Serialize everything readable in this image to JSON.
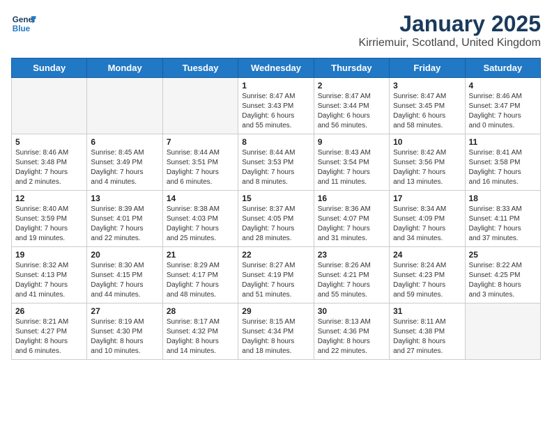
{
  "header": {
    "logo_line1": "General",
    "logo_line2": "Blue",
    "month": "January 2025",
    "location": "Kirriemuir, Scotland, United Kingdom"
  },
  "days_of_week": [
    "Sunday",
    "Monday",
    "Tuesday",
    "Wednesday",
    "Thursday",
    "Friday",
    "Saturday"
  ],
  "weeks": [
    [
      {
        "day": "",
        "content": "",
        "empty": true
      },
      {
        "day": "",
        "content": "",
        "empty": true
      },
      {
        "day": "",
        "content": "",
        "empty": true
      },
      {
        "day": "1",
        "content": "Sunrise: 8:47 AM\nSunset: 3:43 PM\nDaylight: 6 hours\nand 55 minutes."
      },
      {
        "day": "2",
        "content": "Sunrise: 8:47 AM\nSunset: 3:44 PM\nDaylight: 6 hours\nand 56 minutes."
      },
      {
        "day": "3",
        "content": "Sunrise: 8:47 AM\nSunset: 3:45 PM\nDaylight: 6 hours\nand 58 minutes."
      },
      {
        "day": "4",
        "content": "Sunrise: 8:46 AM\nSunset: 3:47 PM\nDaylight: 7 hours\nand 0 minutes."
      }
    ],
    [
      {
        "day": "5",
        "content": "Sunrise: 8:46 AM\nSunset: 3:48 PM\nDaylight: 7 hours\nand 2 minutes."
      },
      {
        "day": "6",
        "content": "Sunrise: 8:45 AM\nSunset: 3:49 PM\nDaylight: 7 hours\nand 4 minutes."
      },
      {
        "day": "7",
        "content": "Sunrise: 8:44 AM\nSunset: 3:51 PM\nDaylight: 7 hours\nand 6 minutes."
      },
      {
        "day": "8",
        "content": "Sunrise: 8:44 AM\nSunset: 3:53 PM\nDaylight: 7 hours\nand 8 minutes."
      },
      {
        "day": "9",
        "content": "Sunrise: 8:43 AM\nSunset: 3:54 PM\nDaylight: 7 hours\nand 11 minutes."
      },
      {
        "day": "10",
        "content": "Sunrise: 8:42 AM\nSunset: 3:56 PM\nDaylight: 7 hours\nand 13 minutes."
      },
      {
        "day": "11",
        "content": "Sunrise: 8:41 AM\nSunset: 3:58 PM\nDaylight: 7 hours\nand 16 minutes."
      }
    ],
    [
      {
        "day": "12",
        "content": "Sunrise: 8:40 AM\nSunset: 3:59 PM\nDaylight: 7 hours\nand 19 minutes."
      },
      {
        "day": "13",
        "content": "Sunrise: 8:39 AM\nSunset: 4:01 PM\nDaylight: 7 hours\nand 22 minutes."
      },
      {
        "day": "14",
        "content": "Sunrise: 8:38 AM\nSunset: 4:03 PM\nDaylight: 7 hours\nand 25 minutes."
      },
      {
        "day": "15",
        "content": "Sunrise: 8:37 AM\nSunset: 4:05 PM\nDaylight: 7 hours\nand 28 minutes."
      },
      {
        "day": "16",
        "content": "Sunrise: 8:36 AM\nSunset: 4:07 PM\nDaylight: 7 hours\nand 31 minutes."
      },
      {
        "day": "17",
        "content": "Sunrise: 8:34 AM\nSunset: 4:09 PM\nDaylight: 7 hours\nand 34 minutes."
      },
      {
        "day": "18",
        "content": "Sunrise: 8:33 AM\nSunset: 4:11 PM\nDaylight: 7 hours\nand 37 minutes."
      }
    ],
    [
      {
        "day": "19",
        "content": "Sunrise: 8:32 AM\nSunset: 4:13 PM\nDaylight: 7 hours\nand 41 minutes."
      },
      {
        "day": "20",
        "content": "Sunrise: 8:30 AM\nSunset: 4:15 PM\nDaylight: 7 hours\nand 44 minutes."
      },
      {
        "day": "21",
        "content": "Sunrise: 8:29 AM\nSunset: 4:17 PM\nDaylight: 7 hours\nand 48 minutes."
      },
      {
        "day": "22",
        "content": "Sunrise: 8:27 AM\nSunset: 4:19 PM\nDaylight: 7 hours\nand 51 minutes."
      },
      {
        "day": "23",
        "content": "Sunrise: 8:26 AM\nSunset: 4:21 PM\nDaylight: 7 hours\nand 55 minutes."
      },
      {
        "day": "24",
        "content": "Sunrise: 8:24 AM\nSunset: 4:23 PM\nDaylight: 7 hours\nand 59 minutes."
      },
      {
        "day": "25",
        "content": "Sunrise: 8:22 AM\nSunset: 4:25 PM\nDaylight: 8 hours\nand 3 minutes."
      }
    ],
    [
      {
        "day": "26",
        "content": "Sunrise: 8:21 AM\nSunset: 4:27 PM\nDaylight: 8 hours\nand 6 minutes."
      },
      {
        "day": "27",
        "content": "Sunrise: 8:19 AM\nSunset: 4:30 PM\nDaylight: 8 hours\nand 10 minutes."
      },
      {
        "day": "28",
        "content": "Sunrise: 8:17 AM\nSunset: 4:32 PM\nDaylight: 8 hours\nand 14 minutes."
      },
      {
        "day": "29",
        "content": "Sunrise: 8:15 AM\nSunset: 4:34 PM\nDaylight: 8 hours\nand 18 minutes."
      },
      {
        "day": "30",
        "content": "Sunrise: 8:13 AM\nSunset: 4:36 PM\nDaylight: 8 hours\nand 22 minutes."
      },
      {
        "day": "31",
        "content": "Sunrise: 8:11 AM\nSunset: 4:38 PM\nDaylight: 8 hours\nand 27 minutes."
      },
      {
        "day": "",
        "content": "",
        "empty": true
      }
    ]
  ]
}
